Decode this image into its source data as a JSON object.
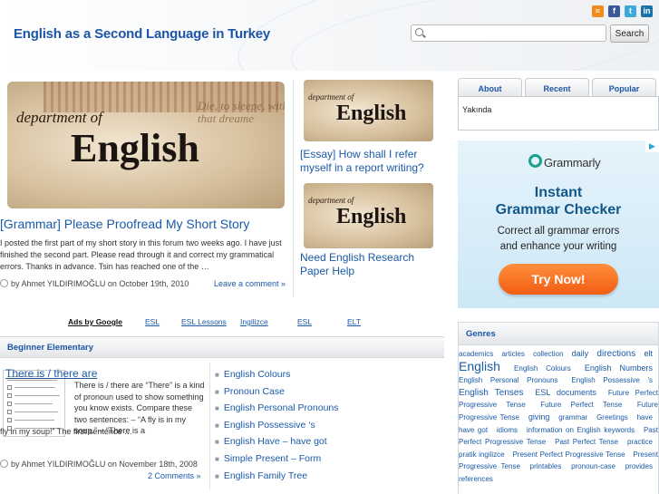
{
  "header": {
    "site_title": "English as a Second Language in Turkey",
    "search_placeholder": "",
    "search_button": "Search",
    "social_icons": [
      "rss-icon",
      "facebook-icon",
      "twitter-icon",
      "linkedin-icon"
    ]
  },
  "featured": {
    "image_text": {
      "dept": "department of",
      "word": "English",
      "bg": "Die, to sleepe, with that dreame"
    },
    "title": "[Grammar] Please Proofread My Short Story",
    "excerpt": "I posted the first part of my short story in this forum two weeks ago. I have just finished the second part. Please read through it and correct my grammatical errors. Thanks in advance. Tsin has reached one of the …",
    "meta": "by Ahmet YILDIRIMOĞLU on October 19th, 2010",
    "comment_link": "Leave a comment »"
  },
  "side_posts": [
    {
      "image_text": {
        "dept": "department of",
        "word": "English"
      },
      "title": "[Essay] How shall I refer myself in a report writing?"
    },
    {
      "image_text": {
        "dept": "department of",
        "word": "English"
      },
      "title": "Need English Research Paper Help"
    }
  ],
  "ads_row": {
    "label": "Ads by Google",
    "links": [
      "ESL",
      "ESL Lessons",
      "Ingilizce",
      "ESL",
      "ELT"
    ]
  },
  "category": {
    "title": "Beginner Elementary",
    "post": {
      "title": "There is / there are",
      "excerpt_a": "There is / there are “There” is a kind of pronoun used to show something you know exists. Compare these two sentences: – “A fly is in my soup.” – “There is a",
      "excerpt_b": "fly in my soup!” The first sentence …",
      "meta": "by Ahmet YILDIRIMOĞLU on November 18th, 2008",
      "comments": "2 Comments »"
    },
    "links": [
      "English Colours",
      "Pronoun Case",
      "English Personal Pronouns",
      "English Possessive ‘s",
      "English Have – have got",
      "Simple Present – Form",
      "English Family Tree"
    ]
  },
  "tabs": {
    "labels": [
      "About",
      "Recent",
      "Popular"
    ],
    "active_content": "Yakında"
  },
  "ad": {
    "brand": "Grammarly",
    "headline_1": "Instant",
    "headline_2": "Grammar Checker",
    "body_1": "Correct all grammar errors",
    "body_2": "and enhance your writing",
    "button": "Try Now!",
    "accent_color": "#f25d13",
    "brand_color": "#13588a"
  },
  "genres": {
    "title": "Genres",
    "tags": [
      {
        "t": "academics",
        "s": 1
      },
      {
        "t": "articles",
        "s": 1
      },
      {
        "t": "collection",
        "s": 1
      },
      {
        "t": "daily",
        "s": 2
      },
      {
        "t": "directions",
        "s": 3
      },
      {
        "t": "elt",
        "s": 2
      },
      {
        "t": "English",
        "s": 4
      },
      {
        "t": "English Colours",
        "s": 1
      },
      {
        "t": "English Numbers",
        "s": 2
      },
      {
        "t": "English Personal Pronouns",
        "s": 1
      },
      {
        "t": "English Possessive 's",
        "s": 1
      },
      {
        "t": "English Tenses",
        "s": 3
      },
      {
        "t": "ESL documents",
        "s": 2
      },
      {
        "t": "Future Perfect Progressive Tense",
        "s": 1
      },
      {
        "t": "Future Perfect Tense",
        "s": 1
      },
      {
        "t": "Future Progressive Tense",
        "s": 1
      },
      {
        "t": "giving",
        "s": 2
      },
      {
        "t": "grammar",
        "s": 1
      },
      {
        "t": "Greetings",
        "s": 1
      },
      {
        "t": "have",
        "s": 1
      },
      {
        "t": "have got",
        "s": 1
      },
      {
        "t": "idioms",
        "s": 1
      },
      {
        "t": "information on English keywords",
        "s": 1
      },
      {
        "t": "Past Perfect Progressive Tense",
        "s": 1
      },
      {
        "t": "Past Perfect Tense",
        "s": 1
      },
      {
        "t": "practice",
        "s": 1
      },
      {
        "t": "pratik ingilizce",
        "s": 1
      },
      {
        "t": "Present Perfect Progressive Tense",
        "s": 1
      },
      {
        "t": "Present Progressive Tense",
        "s": 1
      },
      {
        "t": "printables",
        "s": 1
      },
      {
        "t": "pronoun-case",
        "s": 1
      },
      {
        "t": "provides",
        "s": 1
      },
      {
        "t": "references",
        "s": 1
      }
    ]
  }
}
